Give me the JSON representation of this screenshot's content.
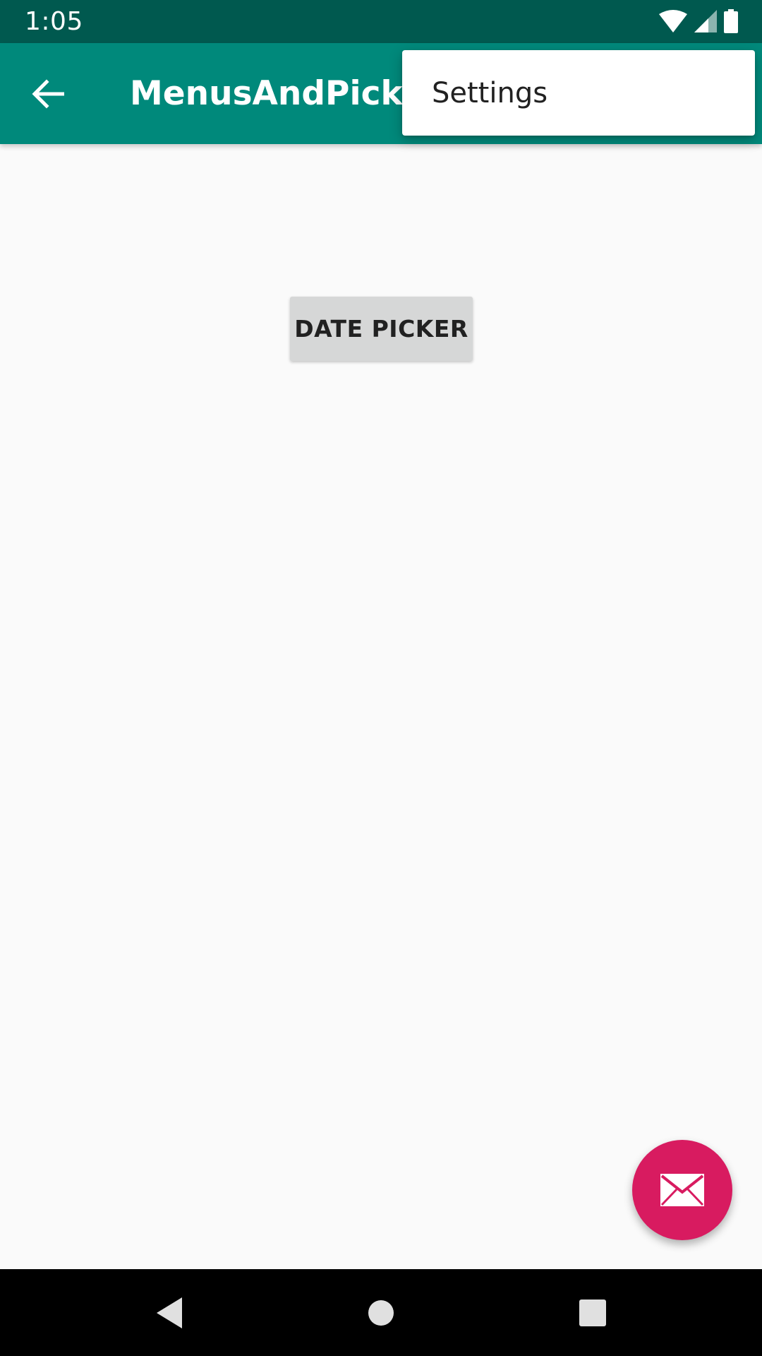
{
  "status_bar": {
    "time": "1:05",
    "icons": [
      "wifi-icon",
      "cell-signal-icon",
      "battery-icon"
    ]
  },
  "app_bar": {
    "title": "MenusAndPicker",
    "back_icon": "arrow-back-icon",
    "color": "#00897b"
  },
  "overflow_menu": {
    "items": [
      {
        "label": "Settings"
      }
    ]
  },
  "main": {
    "date_picker_label": "DATE PICKER"
  },
  "fab": {
    "icon": "mail-icon",
    "color": "#d81b60"
  },
  "nav_bar": {
    "buttons": [
      "nav-back-icon",
      "nav-home-icon",
      "nav-recents-icon"
    ]
  },
  "colors": {
    "status_bar": "#00594f",
    "background": "#fafafa",
    "button": "#d6d7d7"
  }
}
